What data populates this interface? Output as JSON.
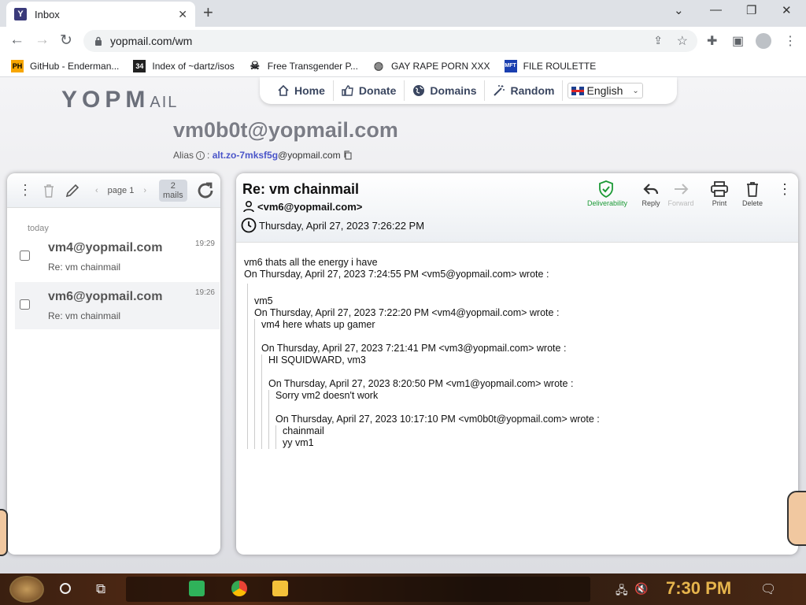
{
  "browser": {
    "tab_title": "Inbox",
    "favicon_letter": "Y",
    "url": "yopmail.com/wm",
    "bookmarks": [
      {
        "label": "GitHub - Enderman...",
        "icon": "PH"
      },
      {
        "label": "Index of ~dartz/isos",
        "icon": "34"
      },
      {
        "label": "Free Transgender P...",
        "icon": "skull"
      },
      {
        "label": "GAY RAPE PORN XXX",
        "icon": "globe"
      },
      {
        "label": "FILE ROULETTE",
        "icon": "MFT"
      }
    ]
  },
  "yopmail": {
    "logo": "YOPM",
    "logo_suffix": "AIL",
    "nav": {
      "home": "Home",
      "donate": "Donate",
      "domains": "Domains",
      "random": "Random",
      "language": "English"
    },
    "address": "vm0b0t@yopmail.com",
    "alias_label": "Alias",
    "alias_value": "alt.zo-7mksf5g",
    "alias_domain": "@yopmail.com"
  },
  "inbox": {
    "page_label": "page 1",
    "count_num": "2",
    "count_label": "mails",
    "group_label": "today",
    "mails": [
      {
        "from": "vm4@yopmail.com",
        "subject": "Re: vm chainmail",
        "time": "19:29"
      },
      {
        "from": "vm6@yopmail.com",
        "subject": "Re: vm chainmail",
        "time": "19:26"
      }
    ]
  },
  "message": {
    "subject": "Re: vm chainmail",
    "from": "<vm6@yopmail.com>",
    "date": "Thursday, April 27, 2023 7:26:22 PM",
    "actions": {
      "deliverability": "Deliverability",
      "reply": "Reply",
      "forward": "Forward",
      "print": "Print",
      "delete": "Delete"
    },
    "body": {
      "l1": "vm6 thats all the energy i have",
      "l2": "On Thursday, April 27, 2023 7:24:55 PM <vm5@yopmail.com> wrote :",
      "l3": "vm5",
      "l4": "On Thursday, April 27, 2023 7:22:20 PM <vm4@yopmail.com> wrote :",
      "l5": "vm4 here whats up gamer",
      "l6": "On Thursday, April 27, 2023 7:21:41 PM <vm3@yopmail.com> wrote :",
      "l7": "HI SQUIDWARD, vm3",
      "l8": "On Thursday, April 27, 2023 8:20:50 PM <vm1@yopmail.com> wrote :",
      "l9": "Sorry vm2 doesn't work",
      "l10": "On Thursday, April 27, 2023 10:17:10 PM <vm0b0t@yopmail.com> wrote :",
      "l11": "chainmail",
      "l12": "yy vm1"
    }
  },
  "taskbar": {
    "clock": "7:30 PM"
  },
  "colors": {
    "alias_accent": "#4a55c9",
    "deliverability_green": "#1c9a36",
    "clock_gold": "#e6b44c"
  }
}
